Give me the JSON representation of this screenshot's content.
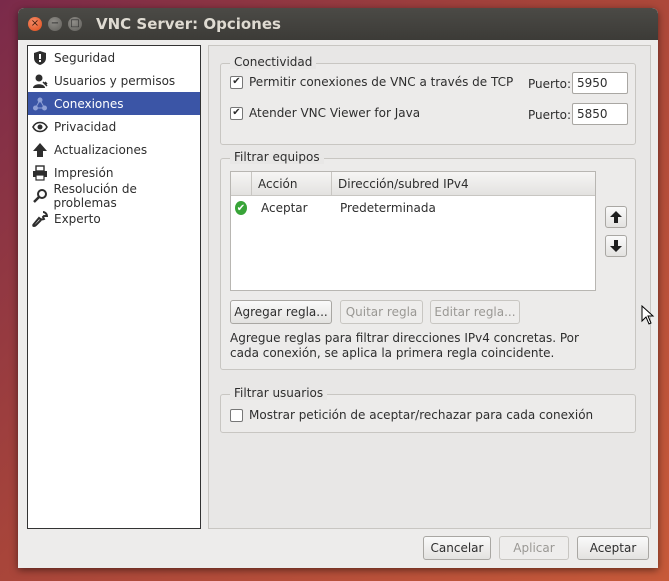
{
  "window": {
    "title": "VNC Server: Opciones",
    "close_glyph": "×",
    "minimize_glyph": "−",
    "maximize_glyph": "□"
  },
  "sidebar": {
    "items": [
      {
        "label": "Seguridad",
        "icon": "shield-icon"
      },
      {
        "label": "Usuarios y permisos",
        "icon": "user-icon"
      },
      {
        "label": "Conexiones",
        "icon": "connections-icon",
        "selected": true
      },
      {
        "label": "Privacidad",
        "icon": "eye-icon"
      },
      {
        "label": "Actualizaciones",
        "icon": "upload-arrow-icon"
      },
      {
        "label": "Impresión",
        "icon": "printer-icon"
      },
      {
        "label": "Resolución de problemas",
        "icon": "magnifier-icon"
      },
      {
        "label": "Experto",
        "icon": "wrench-icon"
      }
    ]
  },
  "connectivity": {
    "legend": "Conectividad",
    "tcp_label": "Permitir conexiones de VNC a través de TCP",
    "tcp_checked": true,
    "tcp_port_label": "Puerto:",
    "tcp_port": "5950",
    "java_label": "Atender VNC Viewer for Java",
    "java_checked": true,
    "java_port_label": "Puerto:",
    "java_port": "5850"
  },
  "filter_hosts": {
    "legend": "Filtrar equipos",
    "columns": [
      "Acción",
      "Dirección/subred IPv4"
    ],
    "rows": [
      {
        "action": "Aceptar",
        "address": "Predeterminada",
        "status_icon": "check-icon"
      }
    ],
    "add_button": "Agregar regla...",
    "remove_button": "Quitar regla",
    "edit_button": "Editar regla...",
    "help": "Agregue reglas para filtrar direcciones IPv4 concretas. Por cada conexión, se aplica la primera regla coincidente."
  },
  "filter_users": {
    "legend": "Filtrar usuarios",
    "prompt_label": "Mostrar petición de aceptar/rechazar para cada conexión",
    "prompt_checked": false
  },
  "buttons": {
    "cancel": "Cancelar",
    "apply": "Aplicar",
    "accept": "Aceptar"
  },
  "colors": {
    "selection": "#3b55a6",
    "close_button": "#df4a16",
    "titlebar": "#3c3b37"
  }
}
